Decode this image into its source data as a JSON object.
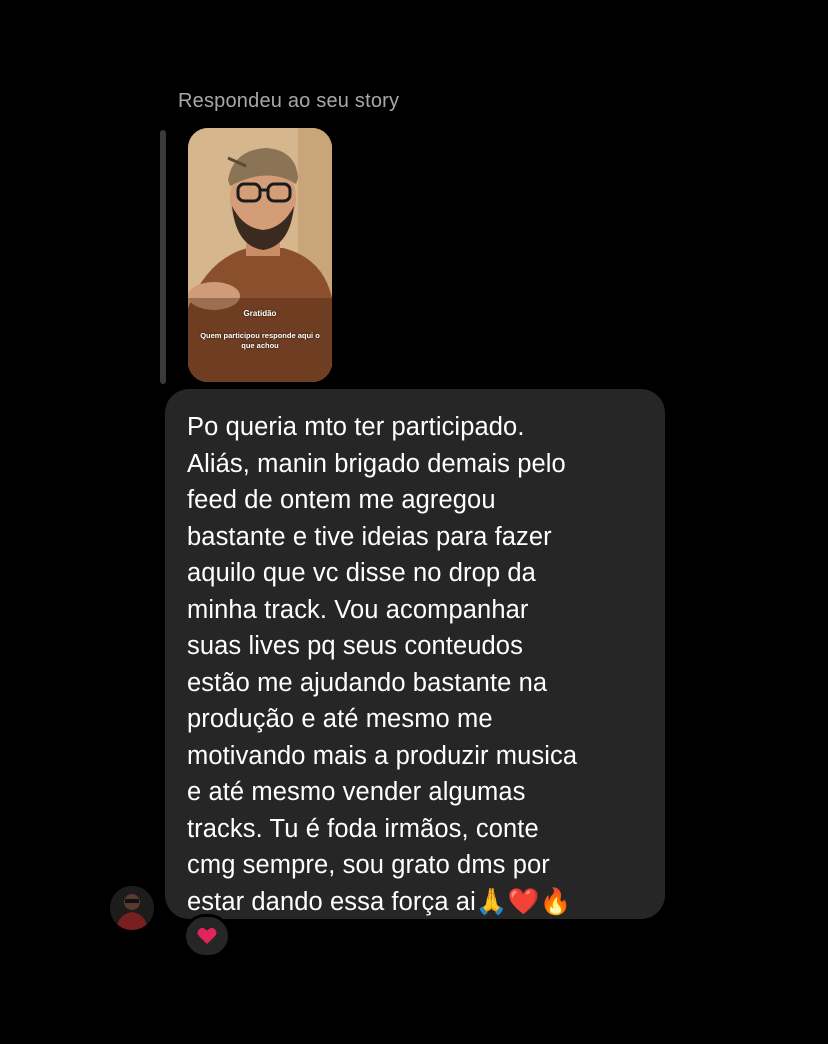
{
  "reply_context": {
    "label": "Respondeu ao seu story"
  },
  "story": {
    "caption_title": "Gratidão",
    "caption_text": "Quem participou responde aqui o que achou"
  },
  "message": {
    "text": "Po queria mto ter participado.\nAliás, manin brigado demais pelo\nfeed de ontem me agregou\nbastante e tive ideias para fazer\naquilo que vc disse no drop da\nminha track. Vou acompanhar\nsuas lives pq seus conteudos\nestão me ajudando bastante na\nprodução e até mesmo me\nmotivando mais a produzir musica\ne até mesmo vender algumas\ntracks. Tu é foda irmãos, conte\ncmg sempre, sou grato dms por\nestar dando essa força ai🙏❤️🔥"
  },
  "reaction": {
    "icon": "heart-icon",
    "emoji": "❤️"
  },
  "colors": {
    "background": "#000000",
    "bubble": "#262626",
    "label": "#a8a8a8",
    "heart": "#e0245e"
  }
}
